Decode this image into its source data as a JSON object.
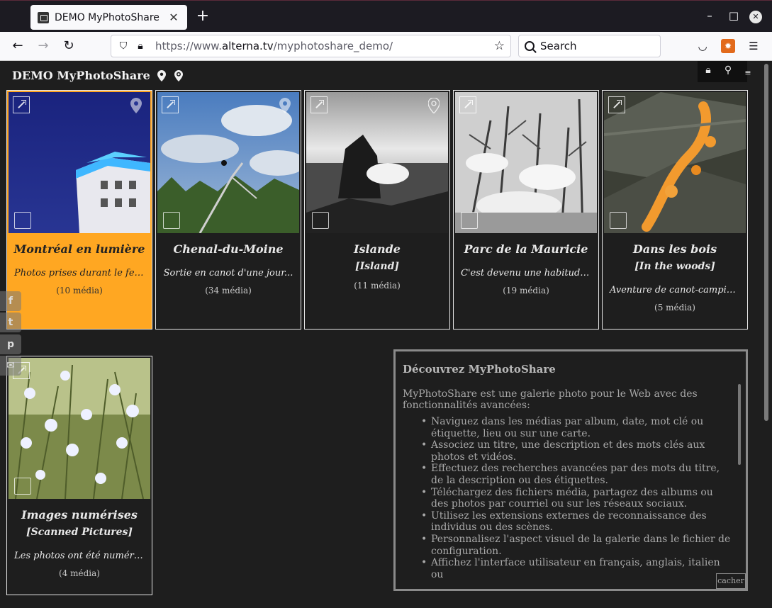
{
  "browser": {
    "tab_title": "DEMO MyPhotoShare",
    "tab_close": "✕",
    "new_tab": "+",
    "url_prefix": "https://www.",
    "url_host": "alterna.tv",
    "url_path": "/myphotoshare_demo/",
    "search_placeholder": "Search"
  },
  "header": {
    "title": "DEMO MyPhotoShare"
  },
  "albums": [
    {
      "title": "Montréal en lumière",
      "subtitle": "",
      "description": "Photos prises durant le fes...",
      "count": "(10 média)",
      "selected": true
    },
    {
      "title": "Chenal-du-Moine",
      "subtitle": "",
      "description": "Sortie en canot d'une jour...",
      "count": "(34 média)",
      "selected": false
    },
    {
      "title": "Islande",
      "subtitle": "[Island]",
      "description": "",
      "count": "(11 média)",
      "selected": false
    },
    {
      "title": "Parc de la Mauricie",
      "subtitle": "",
      "description": "C'est devenu une habitude...",
      "count": "(19 média)",
      "selected": false
    },
    {
      "title": "Dans les bois",
      "subtitle": "[In the woods]",
      "description": "Aventure de canot-campin...",
      "count": "(5 média)",
      "selected": false
    },
    {
      "title": "Images numérises",
      "subtitle": "[Scanned Pictures]",
      "description": "Les photos ont été numéri...",
      "count": "(4 média)",
      "selected": false
    }
  ],
  "social": {
    "facebook": "f",
    "twitter": "t",
    "pinterest": "p",
    "email": "✉"
  },
  "info_panel": {
    "title": "Découvrez MyPhotoShare",
    "intro": "MyPhotoShare est une galerie photo pour le Web avec des fonctionnalités avancées:",
    "items": [
      "Naviguez dans les médias par album, date, mot clé ou étiquette, lieu ou sur une carte.",
      "Associez un titre, une description et des mots clés aux photos et vidéos.",
      "Effectuez des recherches avancées par des mots du titre, de la description ou des étiquettes.",
      "Téléchargez des fichiers média, partagez des albums ou des photos par courriel ou sur les réseaux sociaux.",
      "Utilisez les extensions externes de reconnaissance des individus ou des scènes.",
      "Personnalisez l'aspect visuel de la galerie dans le fichier de configuration.",
      "Affichez l'interface utilisateur en français, anglais, italien ou"
    ],
    "hide_label": "cacher"
  },
  "colors": {
    "selected_card": "#ffa722",
    "page_bg": "#1e1e1e"
  }
}
